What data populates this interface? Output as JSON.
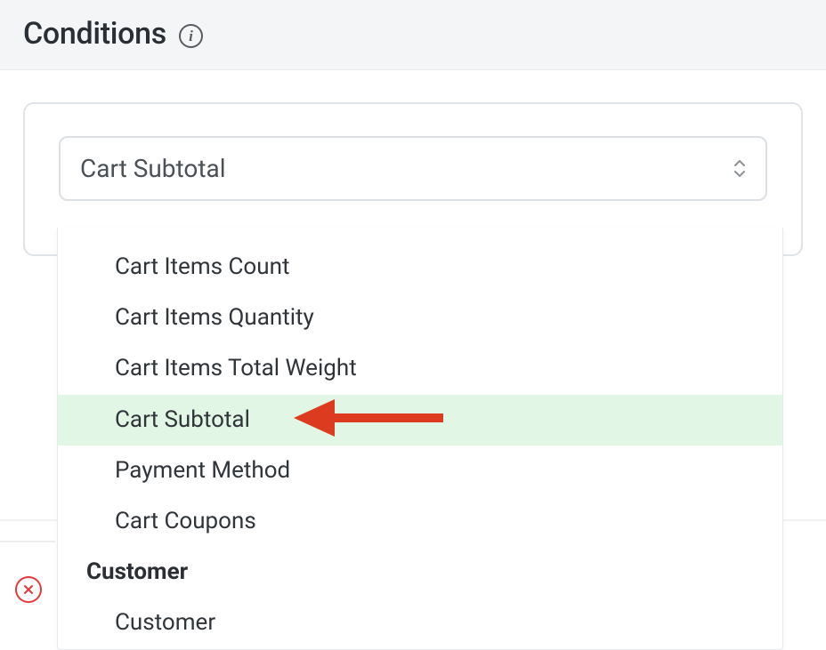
{
  "header": {
    "title": "Conditions"
  },
  "select": {
    "value": "Cart Subtotal"
  },
  "dropdown": {
    "options_above": [
      "Cart Items Count",
      "Cart Items Quantity",
      "Cart Items Total Weight"
    ],
    "highlighted": "Cart Subtotal",
    "options_below": [
      "Payment Method",
      "Cart Coupons"
    ],
    "group_label": "Customer",
    "group_options": [
      "Customer"
    ]
  }
}
